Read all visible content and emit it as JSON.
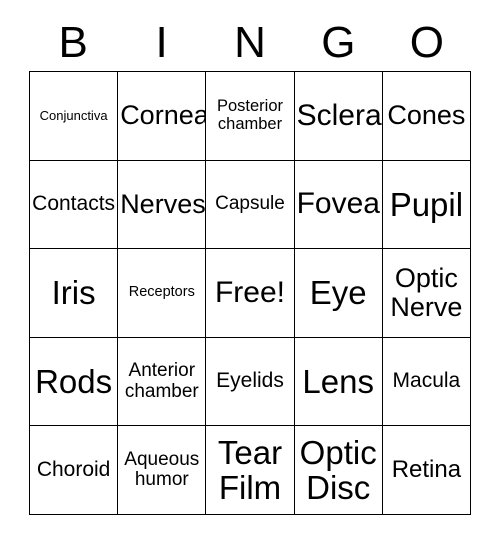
{
  "card": {
    "title_letters": [
      "B",
      "I",
      "N",
      "G",
      "O"
    ],
    "colors": {
      "background": "#ffffff",
      "text": "#000000",
      "grid_line": "#000000"
    },
    "rows": [
      [
        {
          "text": "Conjunctiva",
          "size": "fs-xs"
        },
        {
          "text": "Cornea",
          "size": "fs-xl"
        },
        {
          "text": "Posterior\nchamber",
          "size": "fs-sm"
        },
        {
          "text": "Sclera",
          "size": "fs-xxl"
        },
        {
          "text": "Cones",
          "size": "fs-xl"
        }
      ],
      [
        {
          "text": "Contacts",
          "size": "fs-ml"
        },
        {
          "text": "Nerves",
          "size": "fs-xl"
        },
        {
          "text": "Capsule",
          "size": "fs-m"
        },
        {
          "text": "Fovea",
          "size": "fs-xxl"
        },
        {
          "text": "Pupil",
          "size": "fs-3xl"
        }
      ],
      [
        {
          "text": "Iris",
          "size": "fs-3xl"
        },
        {
          "text": "Receptors",
          "size": "fs-s"
        },
        {
          "text": "Free!",
          "size": "fs-xxl"
        },
        {
          "text": "Eye",
          "size": "fs-3xl"
        },
        {
          "text": "Optic\nNerve",
          "size": "fs-xl"
        }
      ],
      [
        {
          "text": "Rods",
          "size": "fs-3xl"
        },
        {
          "text": "Anterior\nchamber",
          "size": "fs-m"
        },
        {
          "text": "Eyelids",
          "size": "fs-ml"
        },
        {
          "text": "Lens",
          "size": "fs-3xl"
        },
        {
          "text": "Macula",
          "size": "fs-ml"
        }
      ],
      [
        {
          "text": "Choroid",
          "size": "fs-ml"
        },
        {
          "text": "Aqueous\nhumor",
          "size": "fs-m"
        },
        {
          "text": "Tear\nFilm",
          "size": "fs-3xl"
        },
        {
          "text": "Optic\nDisc",
          "size": "fs-3xl"
        },
        {
          "text": "Retina",
          "size": "fs-l"
        }
      ]
    ]
  }
}
